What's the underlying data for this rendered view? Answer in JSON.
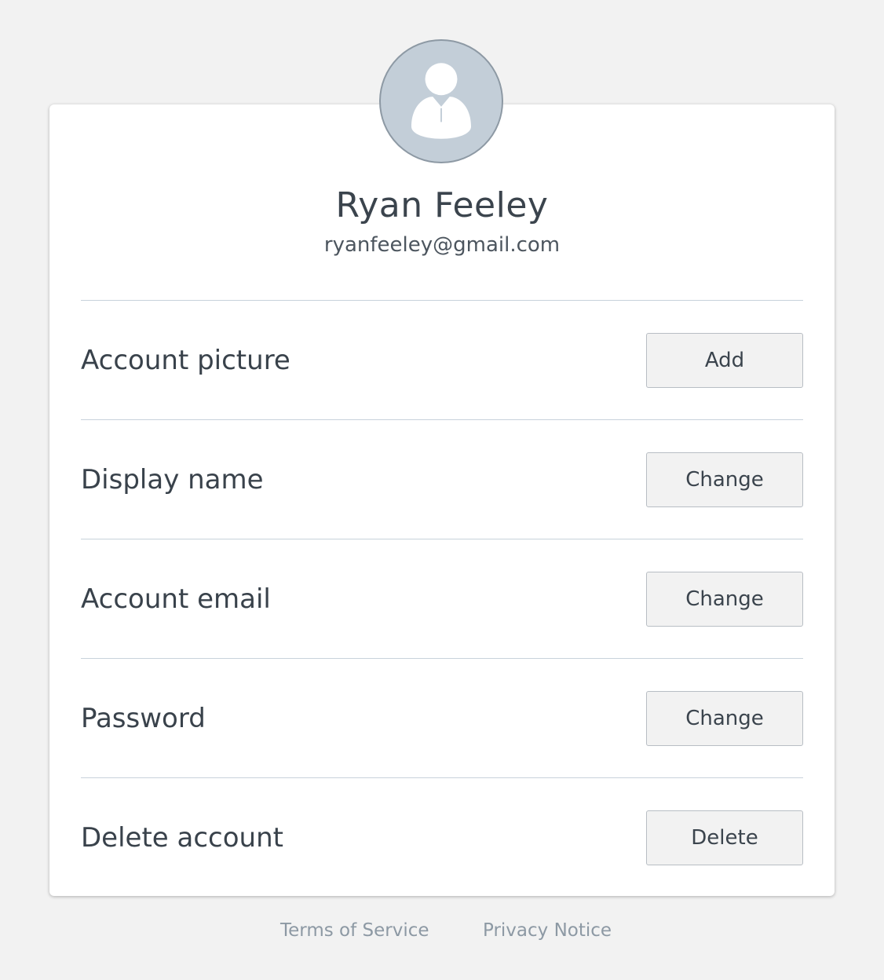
{
  "profile": {
    "name": "Ryan Feeley",
    "email": "ryanfeeley@gmail.com",
    "avatar_icon": "default-user-avatar"
  },
  "settings": [
    {
      "label": "Account picture",
      "button": "Add"
    },
    {
      "label": "Display name",
      "button": "Change"
    },
    {
      "label": "Account email",
      "button": "Change"
    },
    {
      "label": "Password",
      "button": "Change"
    },
    {
      "label": "Delete account",
      "button": "Delete"
    }
  ],
  "footer": {
    "terms": "Terms of Service",
    "privacy": "Privacy Notice"
  },
  "colors": {
    "background": "#f2f2f2",
    "card": "#ffffff",
    "avatar_fill": "#c3ced8",
    "avatar_border": "#8d99a4",
    "text": "#3b444d",
    "footer_link": "#8d99a4",
    "button_bg": "#f2f2f2"
  }
}
